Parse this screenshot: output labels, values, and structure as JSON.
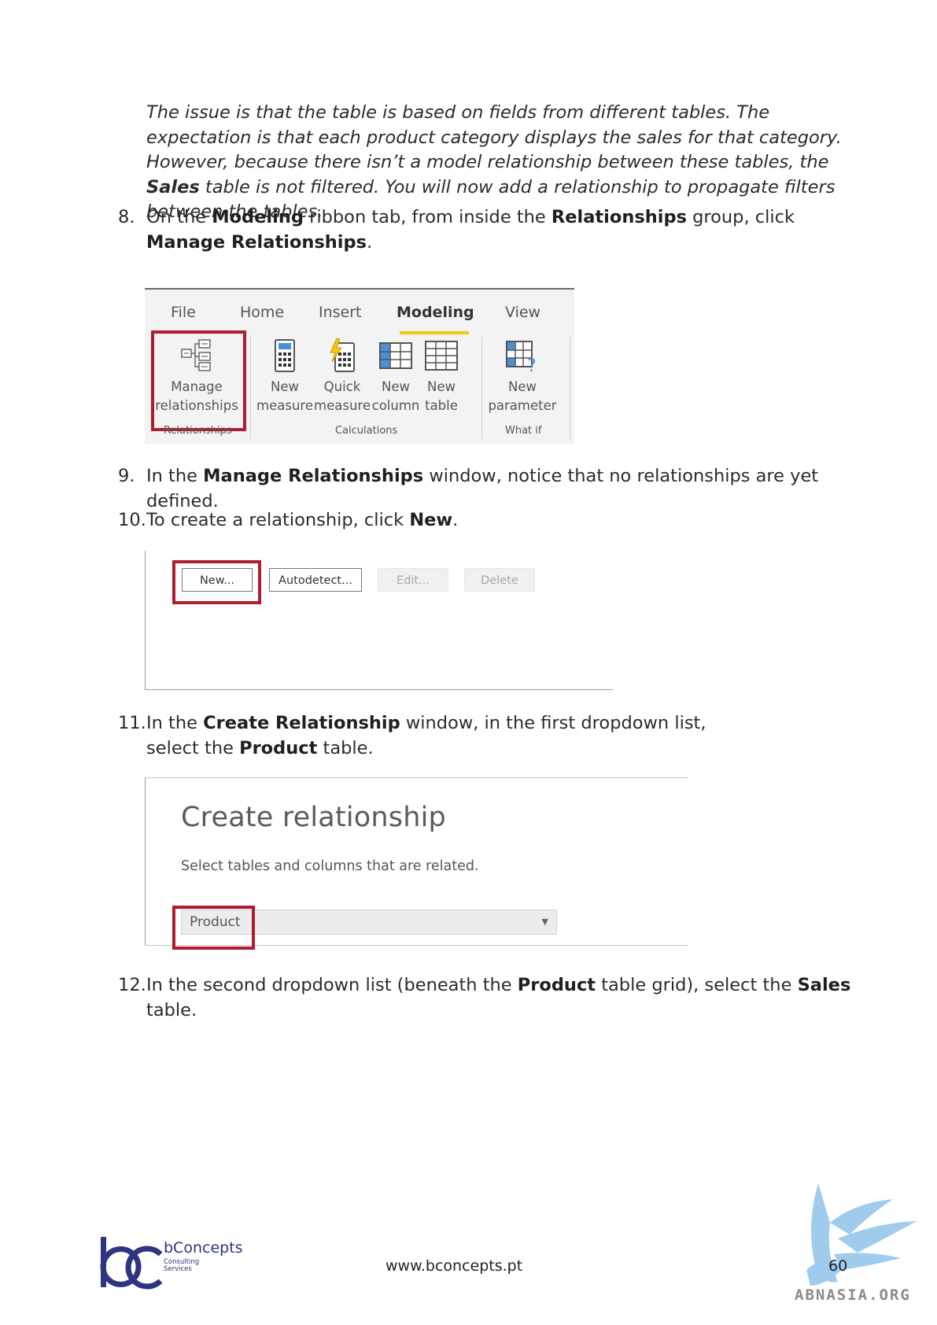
{
  "intro": {
    "part1": "The issue is that the table is based on fields from different tables. The expectation is that each product category displays the sales for that category. However, because there isn’t a model relationship between these tables, the ",
    "bold": "Sales",
    "part2": " table is not filtered. You will now add a relationship to propagate filters between the tables."
  },
  "steps": [
    {
      "num": "8.",
      "t1": "On the ",
      "b1": "Modeling",
      "t2": " ribbon tab, from inside the ",
      "b2": "Relationships",
      "t3": " group, click ",
      "b3": "Manage Relationships",
      "t4": "."
    },
    {
      "num": "9.",
      "t1": "In the ",
      "b1": "Manage Relationships",
      "t2": " window, notice that no relationships are yet defined."
    },
    {
      "num": "10.",
      "t1": "To create a relationship, click ",
      "b1": "New",
      "t2": "."
    },
    {
      "num": "11.",
      "t1": "In the ",
      "b1": "Create Relationship",
      "t2": " window, in the first dropdown list, select the ",
      "b2": "Product",
      "t3": " table."
    },
    {
      "num": "12.",
      "t1": "In the second dropdown list (beneath the ",
      "b1": "Product",
      "t2": " table grid), select the ",
      "b2": "Sales",
      "t3": " table."
    }
  ],
  "ribbon": {
    "tabs": [
      "File",
      "Home",
      "Insert",
      "Modeling",
      "View"
    ],
    "active_tab": "Modeling",
    "buttons": {
      "manage_l1": "Manage",
      "manage_l2": "relationships",
      "new_measure_l1": "New",
      "new_measure_l2": "measure",
      "quick_measure_l1": "Quick",
      "quick_measure_l2": "measure",
      "new_column_l1": "New",
      "new_column_l2": "column",
      "new_table_l1": "New",
      "new_table_l2": "table",
      "new_param_l1": "New",
      "new_param_l2": "parameter"
    },
    "groups": {
      "relationships": "Relationships",
      "calculations": "Calculations",
      "whatif": "What if"
    }
  },
  "relationship_buttons": {
    "new": "New...",
    "autodetect": "Autodetect...",
    "edit": "Edit...",
    "delete": "Delete"
  },
  "create_relationship": {
    "title": "Create relationship",
    "subtitle": "Select tables and columns that are related.",
    "dropdown_value": "Product"
  },
  "footer": {
    "brand": "bConcepts",
    "brand_sub_1": "Consulting",
    "brand_sub_2": "Services",
    "url": "www.bconcepts.pt",
    "page": "60",
    "watermark": "ABNASIA.ORG"
  },
  "colors": {
    "highlight": "#b01c2e",
    "active_tab_underline": "#f2c811",
    "brand": "#2d3580"
  }
}
